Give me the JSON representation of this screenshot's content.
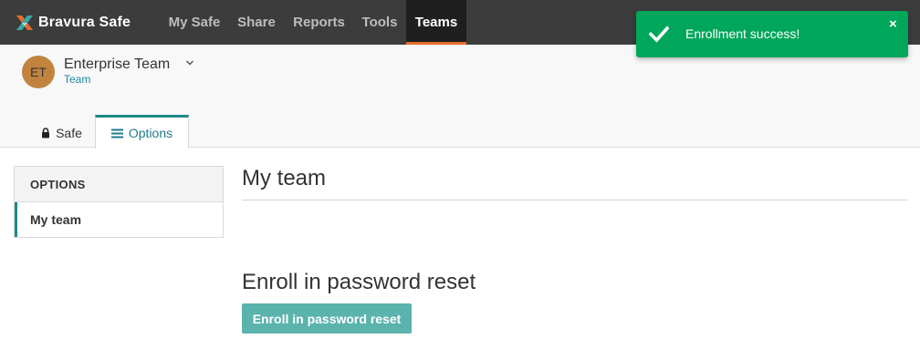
{
  "app": {
    "brand": "Bravura Safe",
    "brand_icon": "bravura-logo-icon"
  },
  "nav": {
    "items": [
      {
        "label": "My Safe",
        "active": false
      },
      {
        "label": "Share",
        "active": false
      },
      {
        "label": "Reports",
        "active": false
      },
      {
        "label": "Tools",
        "active": false
      },
      {
        "label": "Teams",
        "active": true
      }
    ]
  },
  "team": {
    "initials": "ET",
    "name": "Enterprise Team",
    "type": "Team",
    "avatar_color": "#c0843f",
    "dropdown_icon": "chevron-down-icon"
  },
  "tabs": [
    {
      "label": "Safe",
      "icon": "lock-icon",
      "active": false
    },
    {
      "label": "Options",
      "icon": "list-icon",
      "active": true
    }
  ],
  "sidebar": {
    "heading": "OPTIONS",
    "items": [
      {
        "label": "My team",
        "active": true
      }
    ]
  },
  "main": {
    "title": "My team",
    "enroll_heading": "Enroll in password reset",
    "enroll_button": "Enroll in password reset"
  },
  "toast": {
    "message": "Enrollment success!",
    "close_glyph": "×",
    "icon": "checkmark-icon",
    "color": "#00a65a"
  },
  "colors": {
    "accent": "#1d8a87",
    "nav_active_underline": "#e36d2b",
    "button": "#5bb3ad",
    "link": "#1f8a9e"
  }
}
